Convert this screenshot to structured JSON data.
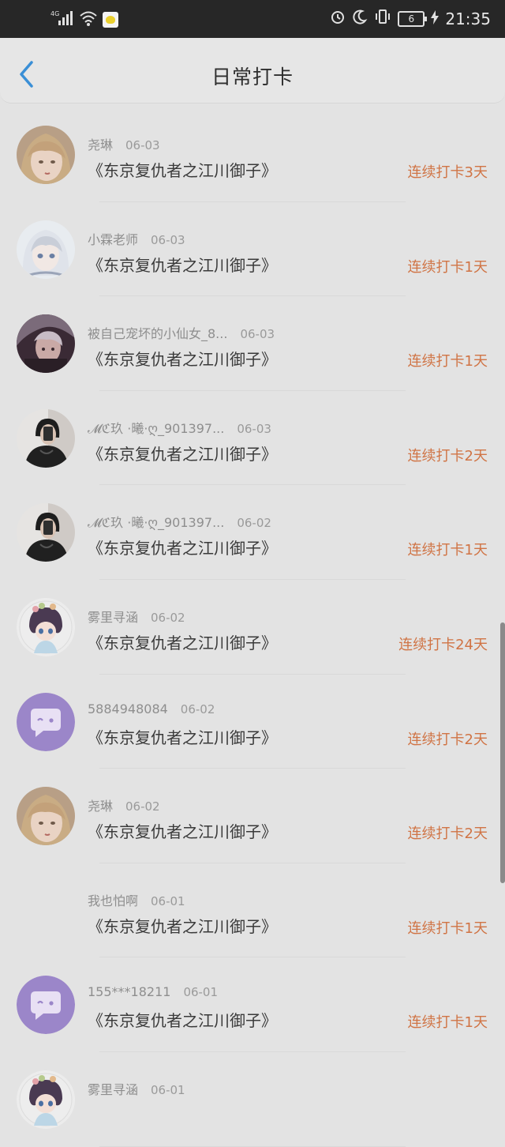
{
  "status": {
    "network": "4G",
    "time": "21:35",
    "battery": "6"
  },
  "nav": {
    "title": "日常打卡"
  },
  "items": [
    {
      "user": "尧琳",
      "date": "06-03",
      "work": "《东京复仇者之江川御子》",
      "streak": "连续打卡3天",
      "avatar": "girl-blonde"
    },
    {
      "user": "小霖老师",
      "date": "06-03",
      "work": "《东京复仇者之江川御子》",
      "streak": "连续打卡1天",
      "avatar": "girl-white-hair"
    },
    {
      "user": "被自己宠坏的小仙女_8...",
      "date": "06-03",
      "work": "《东京复仇者之江川御子》",
      "streak": "连续打卡1天",
      "avatar": "girl-dark"
    },
    {
      "user": "𝓜ℭ玖 ·曦·ღ_901397...",
      "date": "06-03",
      "work": "《东京复仇者之江川御子》",
      "streak": "连续打卡2天",
      "avatar": "photo-person"
    },
    {
      "user": "𝓜ℭ玖 ·曦·ღ_901397...",
      "date": "06-02",
      "work": "《东京复仇者之江川御子》",
      "streak": "连续打卡1天",
      "avatar": "photo-person"
    },
    {
      "user": "雾里寻涵",
      "date": "06-02",
      "work": "《东京复仇者之江川御子》",
      "streak": "连续打卡24天",
      "avatar": "chibi"
    },
    {
      "user": "5884948084",
      "date": "06-02",
      "work": "《东京复仇者之江川御子》",
      "streak": "连续打卡2天",
      "avatar": "default-chat"
    },
    {
      "user": "尧琳",
      "date": "06-02",
      "work": "《东京复仇者之江川御子》",
      "streak": "连续打卡2天",
      "avatar": "girl-blonde"
    },
    {
      "user": "我也怕啊",
      "date": "06-01",
      "work": "《东京复仇者之江川御子》",
      "streak": "连续打卡1天",
      "avatar": "none"
    },
    {
      "user": "155***18211",
      "date": "06-01",
      "work": "《东京复仇者之江川御子》",
      "streak": "连续打卡1天",
      "avatar": "default-chat"
    },
    {
      "user": "雾里寻涵",
      "date": "06-01",
      "work": "",
      "streak": "",
      "avatar": "chibi"
    }
  ],
  "colors": {
    "accent": "#d07445",
    "back": "#3a8fd6"
  }
}
